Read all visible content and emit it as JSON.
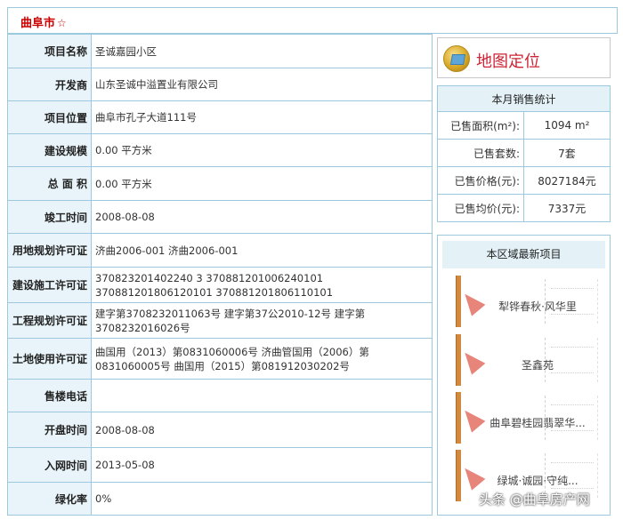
{
  "header": {
    "city": "曲阜市",
    "star": "☆"
  },
  "details": [
    {
      "label": "项目名称",
      "value": "圣诚嘉园小区"
    },
    {
      "label": "开发商",
      "value": "山东圣诚中溢置业有限公司"
    },
    {
      "label": "项目位置",
      "value": "曲阜市孔子大道111号"
    },
    {
      "label": "建设规模",
      "value": "0.00 平方米"
    },
    {
      "label": "总 面 积",
      "value": "0.00 平方米"
    },
    {
      "label": "竣工时间",
      "value": "2008-08-08"
    },
    {
      "label": "用地规划许可证",
      "value": "济曲2006-001 济曲2006-001"
    },
    {
      "label": "建设施工许可证",
      "value": "370823201402240 3 370881201006240101 370881201806120101 370881201806110101"
    },
    {
      "label": "工程规划许可证",
      "value": "建字第3708232011063号 建字第37公2010-12号 建字第3708232016026号"
    },
    {
      "label": "土地使用许可证",
      "value": "曲国用（2013）第0831060006号 济曲管国用（2006）第0831060005号 曲国用（2015）第081912030202号"
    },
    {
      "label": "售楼电话",
      "value": ""
    },
    {
      "label": "开盘时间",
      "value": "2008-08-08"
    },
    {
      "label": "入网时间",
      "value": "2013-05-08"
    },
    {
      "label": "绿化率",
      "value": "0%"
    }
  ],
  "map_button": {
    "label": "地图定位",
    "icon": "map-icon"
  },
  "sales": {
    "title": "本月销售统计",
    "rows": [
      {
        "key": "已售面积(m²):",
        "value": "1094 m²"
      },
      {
        "key": "已售套数:",
        "value": "7套"
      },
      {
        "key": "已售价格(元):",
        "value": "8027184元"
      },
      {
        "key": "已售均价(元):",
        "value": "7337元"
      }
    ]
  },
  "new_projects": {
    "title": "本区域最新项目",
    "items": [
      {
        "name": "犁铧春秋·风华里"
      },
      {
        "name": "圣鑫苑"
      },
      {
        "name": "曲阜碧桂园翡翠华..."
      },
      {
        "name": "绿城·诚园·守纯..."
      }
    ]
  },
  "watermark": "头条 @曲阜房产网",
  "colors": {
    "border": "#9cc9dd",
    "label_bg": "#e8f4f9",
    "accent_red": "#cc0000"
  }
}
